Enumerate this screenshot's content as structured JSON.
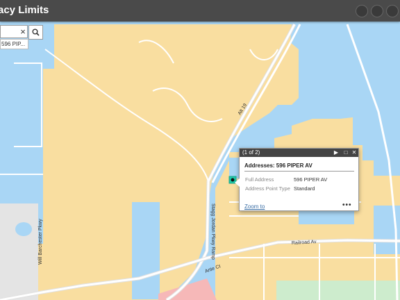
{
  "app": {
    "title": "acy Limits"
  },
  "search": {
    "value": "",
    "suggestion": "596 PIP...",
    "clear_glyph": "×"
  },
  "popup": {
    "counter": "(1 of 2)",
    "title": "Addresses: 596 PIPER AV",
    "fields": [
      {
        "label": "Full Address",
        "value": "596 PIPER AV"
      },
      {
        "label": "Address Point Type",
        "value": "Standard"
      }
    ],
    "zoom_label": "Zoom to",
    "more_label": "•••",
    "next_glyph": "▶",
    "maximize_glyph": "□",
    "close_glyph": "✕"
  },
  "map": {
    "road_labels": [
      "Alt 19",
      "Will Barchester Pkwy",
      "Stagg Jordan Pkwy Ramp",
      "Railroad Av",
      "Artie Ct"
    ],
    "colors": {
      "water": "#a9d6f5",
      "land": "#f9dea0",
      "road": "#ffffff",
      "park": "#cdeccd",
      "commercial": "#f6b8b8",
      "gray": "#e4e4e4",
      "marker": "#20c8a8"
    }
  },
  "icons": [
    "search-icon",
    "close-icon",
    "chevron-right-icon",
    "maximize-icon",
    "more-icon",
    "location-marker-icon"
  ]
}
